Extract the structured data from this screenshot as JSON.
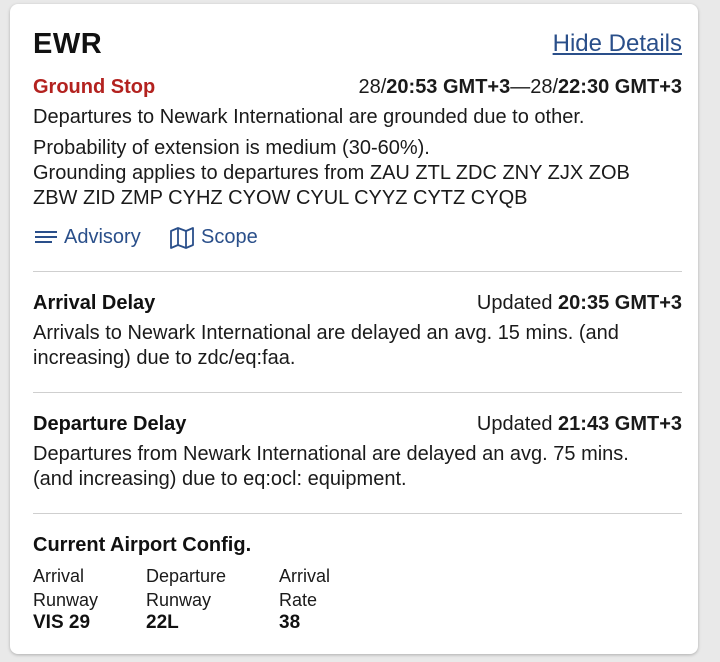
{
  "airport": {
    "code": "EWR",
    "toggle_label": "Hide Details"
  },
  "ground_stop": {
    "label": "Ground Stop",
    "start_prefix": "28/",
    "start_time": "20:53 GMT+3",
    "separator": "—28/",
    "end_time": "22:30 GMT+3",
    "description": "Departures to Newark International are grounded due to other.",
    "probability": "Probability of extension is medium (30-60%).",
    "applies_line1": "Grounding applies to departures from ZAU ZTL ZDC ZNY ZJX ZOB",
    "applies_line2": "ZBW ZID ZMP CYHZ CYOW CYUL CYYZ CYTZ CYQB",
    "advisory_label": "Advisory",
    "scope_label": "Scope"
  },
  "arrival_delay": {
    "title": "Arrival Delay",
    "updated_prefix": "Updated ",
    "updated_time": "20:35 GMT+3",
    "line1": "Arrivals to Newark International are delayed an avg. 15 mins. (and",
    "line2": "increasing) due to zdc/eq:faa."
  },
  "departure_delay": {
    "title": "Departure Delay",
    "updated_prefix": "Updated ",
    "updated_time": "21:43 GMT+3",
    "line1": "Departures from Newark International are delayed an avg. 75 mins.",
    "line2": "(and increasing) due to eq:ocl: equipment."
  },
  "config": {
    "title": "Current Airport Config.",
    "columns": [
      {
        "label1": "Arrival",
        "label2": "Runway",
        "value": "VIS 29"
      },
      {
        "label1": "Departure",
        "label2": "Runway",
        "value": "22L"
      },
      {
        "label1": "Arrival",
        "label2": "Rate",
        "value": "38"
      }
    ]
  },
  "colors": {
    "alert_red": "#b3221f",
    "link_blue": "#2a4f8a"
  }
}
